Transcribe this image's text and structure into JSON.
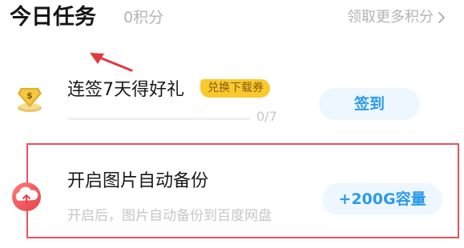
{
  "header": {
    "title": "今日任务",
    "points": "0积分",
    "more_link": "领取更多积分"
  },
  "tasks": [
    {
      "title": "连签7天得好礼",
      "badge": "兑换下载券",
      "progress_text": "0/7",
      "progress_value": 0,
      "progress_max": 7,
      "action_label": "签到",
      "icon": "gold-coin-icon"
    },
    {
      "title": "开启图片自动备份",
      "subtitle": "开启后，图片自动备份到百度网盘",
      "action_label": "+200G容量",
      "icon": "cloud-upload-icon"
    }
  ],
  "colors": {
    "accent": "#2a9bea",
    "button_bg": "#eef7ff",
    "badge_bg": "#f9c92e",
    "annotation_red": "#e8525a",
    "muted_text": "#b4b4b4"
  }
}
